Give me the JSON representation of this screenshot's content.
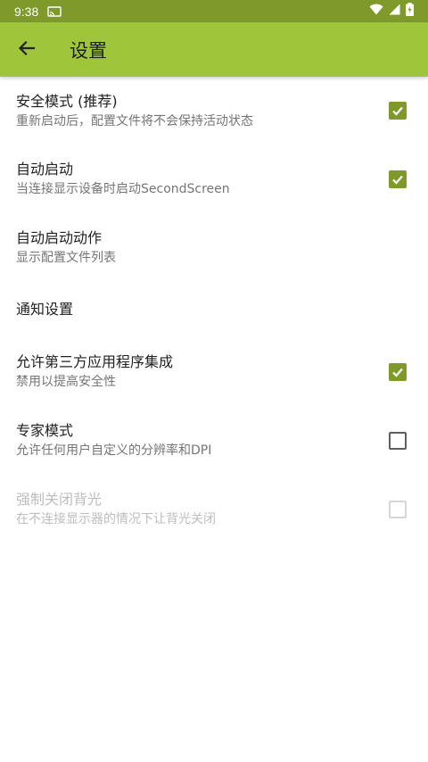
{
  "status_bar": {
    "time": "9:38",
    "cast_icon": "cast-icon",
    "wifi_icon": "wifi-icon",
    "signal_icon": "signal-icon",
    "battery_icon": "battery-charging-icon"
  },
  "app_bar": {
    "title": "设置",
    "back_icon": "arrow-back-icon"
  },
  "colors": {
    "status_bar": "#7f9a2a",
    "app_bar": "#9fc53a",
    "checkbox_checked": "#7f9a2a"
  },
  "settings": [
    {
      "title": "安全模式 (推荐)",
      "summary": "重新启动后，配置文件将不会保持活动状态",
      "checkbox": "checked",
      "enabled": true
    },
    {
      "title": "自动启动",
      "summary": "当连接显示设备时启动SecondScreen",
      "checkbox": "checked",
      "enabled": true
    },
    {
      "title": "自动启动动作",
      "summary": "显示配置文件列表",
      "checkbox": "none",
      "enabled": true
    },
    {
      "title": "通知设置",
      "summary": "",
      "checkbox": "none",
      "enabled": true
    },
    {
      "title": "允许第三方应用程序集成",
      "summary": "禁用以提高安全性",
      "checkbox": "checked",
      "enabled": true
    },
    {
      "title": "专家模式",
      "summary": "允许任何用户自定义的分辨率和DPI",
      "checkbox": "unchecked",
      "enabled": true
    },
    {
      "title": "强制关闭背光",
      "summary": "在不连接显示器的情况下让背光关闭",
      "checkbox": "unchecked",
      "enabled": false
    }
  ]
}
